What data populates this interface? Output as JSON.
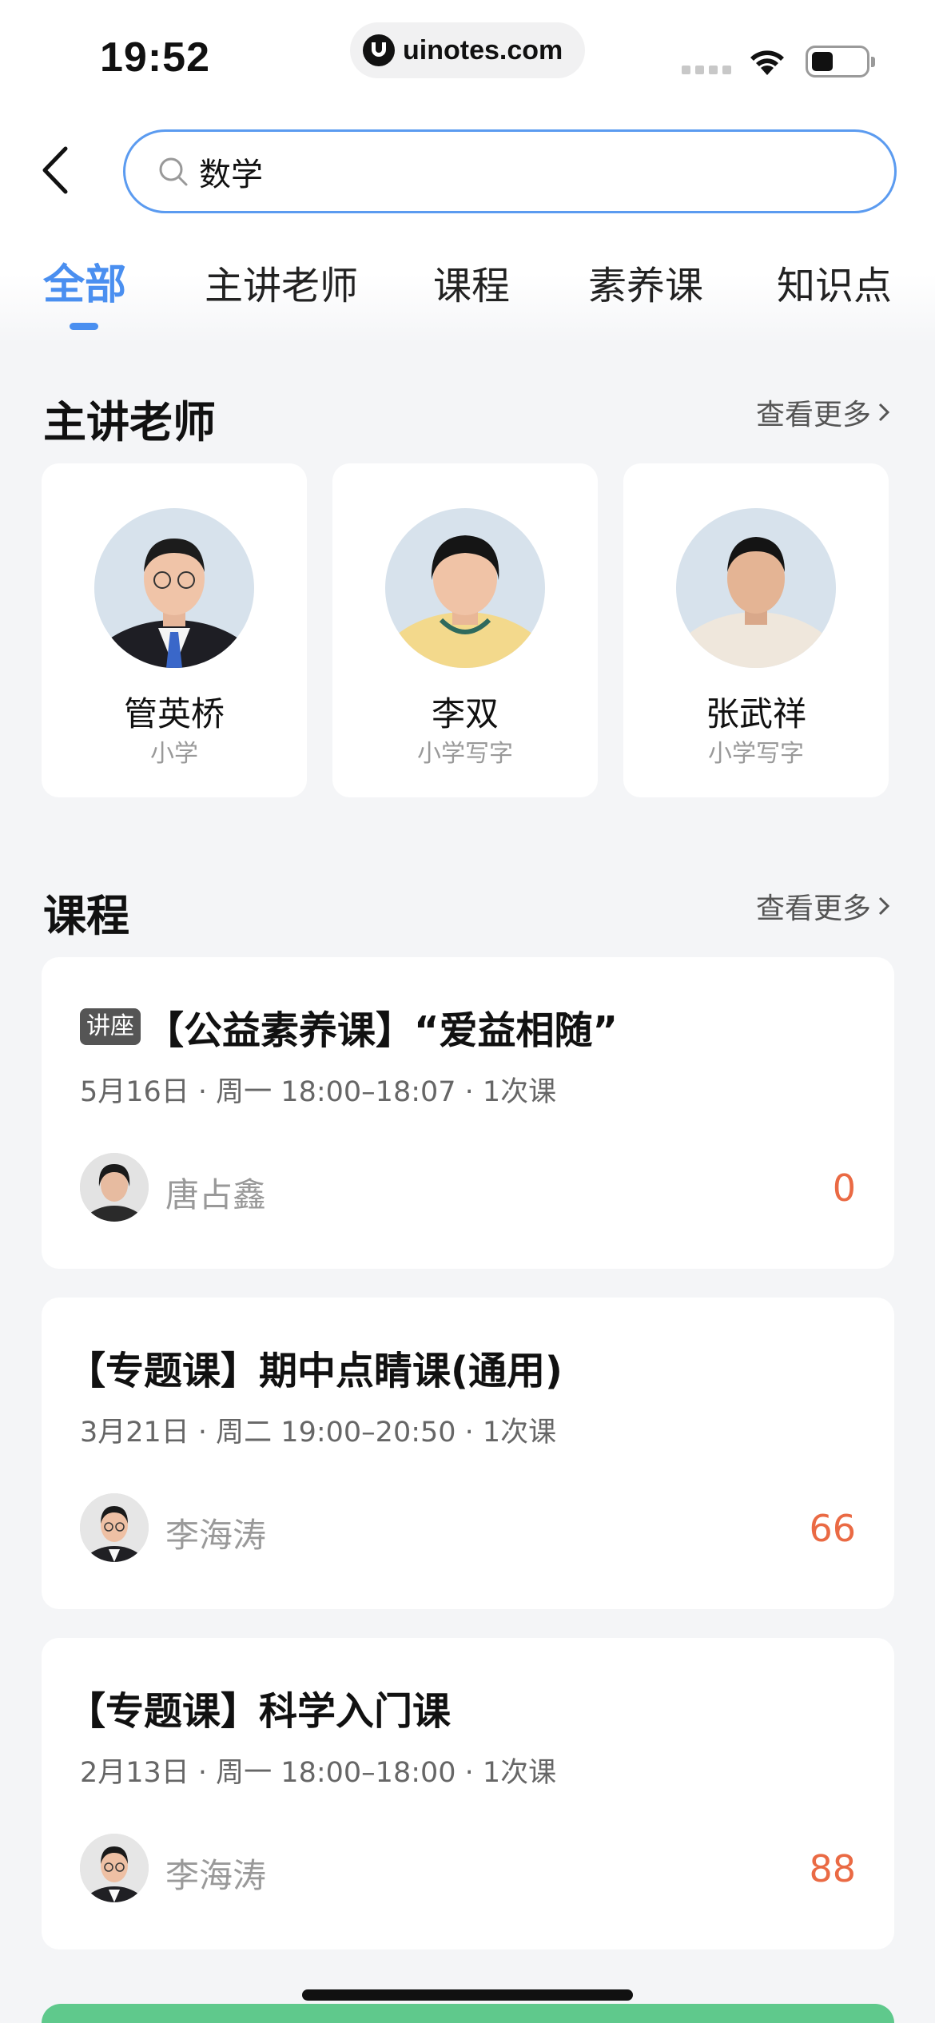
{
  "status_bar": {
    "time": "19:52",
    "url": "uinotes.com"
  },
  "search": {
    "query": "数学"
  },
  "tabs": [
    {
      "label": "全部",
      "active": true
    },
    {
      "label": "主讲老师",
      "active": false
    },
    {
      "label": "课程",
      "active": false
    },
    {
      "label": "素养课",
      "active": false
    },
    {
      "label": "知识点",
      "active": false
    }
  ],
  "teachers_section": {
    "title": "主讲老师",
    "see_more": "查看更多",
    "teachers": [
      {
        "name": "管英桥",
        "subject": "小学"
      },
      {
        "name": "李双",
        "subject": "小学写字"
      },
      {
        "name": "张武祥",
        "subject": "小学写字"
      }
    ]
  },
  "courses_section": {
    "title": "课程",
    "see_more": "查看更多",
    "courses": [
      {
        "badge": "讲座",
        "title": "【公益素养课】“爱益相随”",
        "meta": "5月16日 · 周一 18:00–18:07 · 1次课",
        "teacher": "唐占鑫",
        "count": "0"
      },
      {
        "badge": "",
        "title": "【专题课】期中点睛课(通用)",
        "meta": "3月21日 · 周二 19:00–20:50 · 1次课",
        "teacher": "李海涛",
        "count": "66"
      },
      {
        "badge": "",
        "title": "【专题课】科学入门课",
        "meta": "2月13日 · 周一 18:00–18:00 · 1次课",
        "teacher": "李海涛",
        "count": "88"
      }
    ]
  },
  "colors": {
    "accent": "#4a8ff0",
    "count": "#ea6a44",
    "bottom_bar": "#5fc98c"
  }
}
